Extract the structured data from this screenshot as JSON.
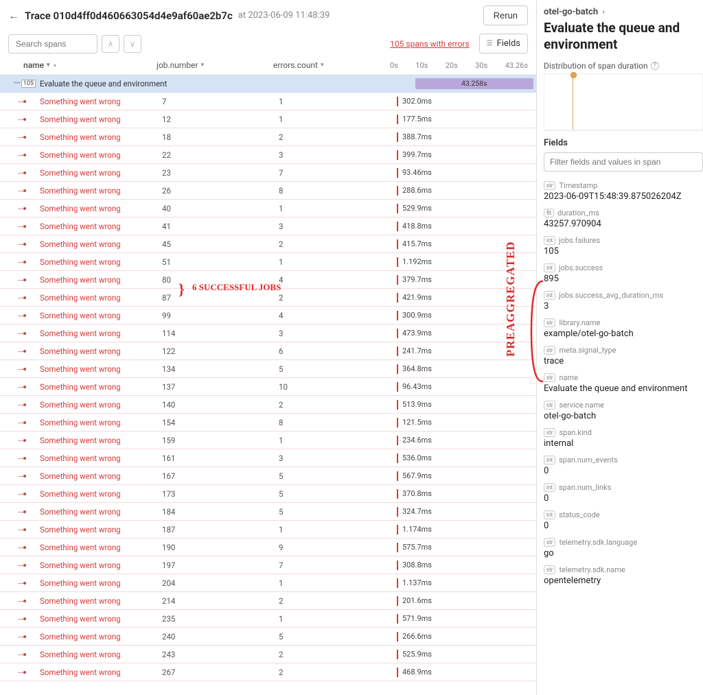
{
  "header": {
    "trace_label": "Trace 010d4ff0d460663054d4e9af60ae2b7c",
    "trace_time": "at 2023-06-09 11:48:39",
    "rerun": "Rerun"
  },
  "toolbar": {
    "search_placeholder": "Search spans",
    "errors_link": "105 spans with errors",
    "fields_button": "Fields"
  },
  "columns": {
    "name": "name",
    "job_number": "job.number",
    "errors_count": "errors.count",
    "ticks": [
      "0s",
      "10s",
      "20s",
      "30s",
      "43.26s"
    ]
  },
  "root_row": {
    "count": "105",
    "name": "Evaluate the queue and environment",
    "bar_label": "43.258s"
  },
  "rows": [
    {
      "name": "Something went wrong",
      "job": "7",
      "err": "1",
      "dur": "302.0ms"
    },
    {
      "name": "Something went wrong",
      "job": "12",
      "err": "1",
      "dur": "177.5ms"
    },
    {
      "name": "Something went wrong",
      "job": "18",
      "err": "2",
      "dur": "388.7ms"
    },
    {
      "name": "Something went wrong",
      "job": "22",
      "err": "3",
      "dur": "399.7ms"
    },
    {
      "name": "Something went wrong",
      "job": "23",
      "err": "7",
      "dur": "93.46ms"
    },
    {
      "name": "Something went wrong",
      "job": "26",
      "err": "8",
      "dur": "288.6ms"
    },
    {
      "name": "Something went wrong",
      "job": "40",
      "err": "1",
      "dur": "529.9ms"
    },
    {
      "name": "Something went wrong",
      "job": "41",
      "err": "3",
      "dur": "418.8ms"
    },
    {
      "name": "Something went wrong",
      "job": "45",
      "err": "2",
      "dur": "415.7ms"
    },
    {
      "name": "Something went wrong",
      "job": "51",
      "err": "1",
      "dur": "1.192ms"
    },
    {
      "name": "Something went wrong",
      "job": "80",
      "err": "4",
      "dur": "379.7ms"
    },
    {
      "name": "Something went wrong",
      "job": "87",
      "err": "2",
      "dur": "421.9ms"
    },
    {
      "name": "Something went wrong",
      "job": "99",
      "err": "4",
      "dur": "300.9ms"
    },
    {
      "name": "Something went wrong",
      "job": "114",
      "err": "3",
      "dur": "473.9ms"
    },
    {
      "name": "Something went wrong",
      "job": "122",
      "err": "6",
      "dur": "241.7ms"
    },
    {
      "name": "Something went wrong",
      "job": "134",
      "err": "5",
      "dur": "364.8ms"
    },
    {
      "name": "Something went wrong",
      "job": "137",
      "err": "10",
      "dur": "96.43ms"
    },
    {
      "name": "Something went wrong",
      "job": "140",
      "err": "2",
      "dur": "513.9ms"
    },
    {
      "name": "Something went wrong",
      "job": "154",
      "err": "8",
      "dur": "121.5ms"
    },
    {
      "name": "Something went wrong",
      "job": "159",
      "err": "1",
      "dur": "234.6ms"
    },
    {
      "name": "Something went wrong",
      "job": "161",
      "err": "3",
      "dur": "536.0ms"
    },
    {
      "name": "Something went wrong",
      "job": "167",
      "err": "5",
      "dur": "567.9ms"
    },
    {
      "name": "Something went wrong",
      "job": "173",
      "err": "5",
      "dur": "370.8ms"
    },
    {
      "name": "Something went wrong",
      "job": "184",
      "err": "5",
      "dur": "324.7ms"
    },
    {
      "name": "Something went wrong",
      "job": "187",
      "err": "1",
      "dur": "1.174ms"
    },
    {
      "name": "Something went wrong",
      "job": "190",
      "err": "9",
      "dur": "575.7ms"
    },
    {
      "name": "Something went wrong",
      "job": "197",
      "err": "7",
      "dur": "308.8ms"
    },
    {
      "name": "Something went wrong",
      "job": "204",
      "err": "1",
      "dur": "1.137ms"
    },
    {
      "name": "Something went wrong",
      "job": "214",
      "err": "2",
      "dur": "201.6ms"
    },
    {
      "name": "Something went wrong",
      "job": "235",
      "err": "1",
      "dur": "571.9ms"
    },
    {
      "name": "Something went wrong",
      "job": "240",
      "err": "5",
      "dur": "266.6ms"
    },
    {
      "name": "Something went wrong",
      "job": "243",
      "err": "2",
      "dur": "525.9ms"
    },
    {
      "name": "Something went wrong",
      "job": "267",
      "err": "2",
      "dur": "468.9ms"
    }
  ],
  "side": {
    "breadcrumb_service": "otel-go-batch",
    "title": "Evaluate the queue and environment",
    "distribution_label": "Distribution of span duration",
    "fields_heading": "Fields",
    "filter_placeholder": "Filter fields and values in span",
    "fields": [
      {
        "type": "str",
        "label": "Timestamp",
        "value": "2023-06-09T15:48:39.875026204Z"
      },
      {
        "type": "flt",
        "label": "duration_ms",
        "value": "43257.970904"
      },
      {
        "type": "int",
        "label": "jobs.failures",
        "value": "105"
      },
      {
        "type": "int",
        "label": "jobs.success",
        "value": "895"
      },
      {
        "type": "int",
        "label": "jobs.success_avg_duration_ms",
        "value": "3"
      },
      {
        "type": "str",
        "label": "library.name",
        "value": "example/otel-go-batch"
      },
      {
        "type": "str",
        "label": "meta.signal_type",
        "value": "trace"
      },
      {
        "type": "str",
        "label": "name",
        "value": "Evaluate the queue and environment"
      },
      {
        "type": "str",
        "label": "service.name",
        "value": "otel-go-batch"
      },
      {
        "type": "str",
        "label": "span.kind",
        "value": "internal"
      },
      {
        "type": "int",
        "label": "span.num_events",
        "value": "0"
      },
      {
        "type": "int",
        "label": "span.num_links",
        "value": "0"
      },
      {
        "type": "int",
        "label": "status_code",
        "value": "0"
      },
      {
        "type": "str",
        "label": "telemetry.sdk.language",
        "value": "go"
      },
      {
        "type": "str",
        "label": "telemetry.sdk.name",
        "value": "opentelemetry"
      }
    ]
  },
  "annotations": {
    "success_jobs": "6 SUCCESSFUL JOBS",
    "preaggregated": "PREAGGREGATED"
  }
}
